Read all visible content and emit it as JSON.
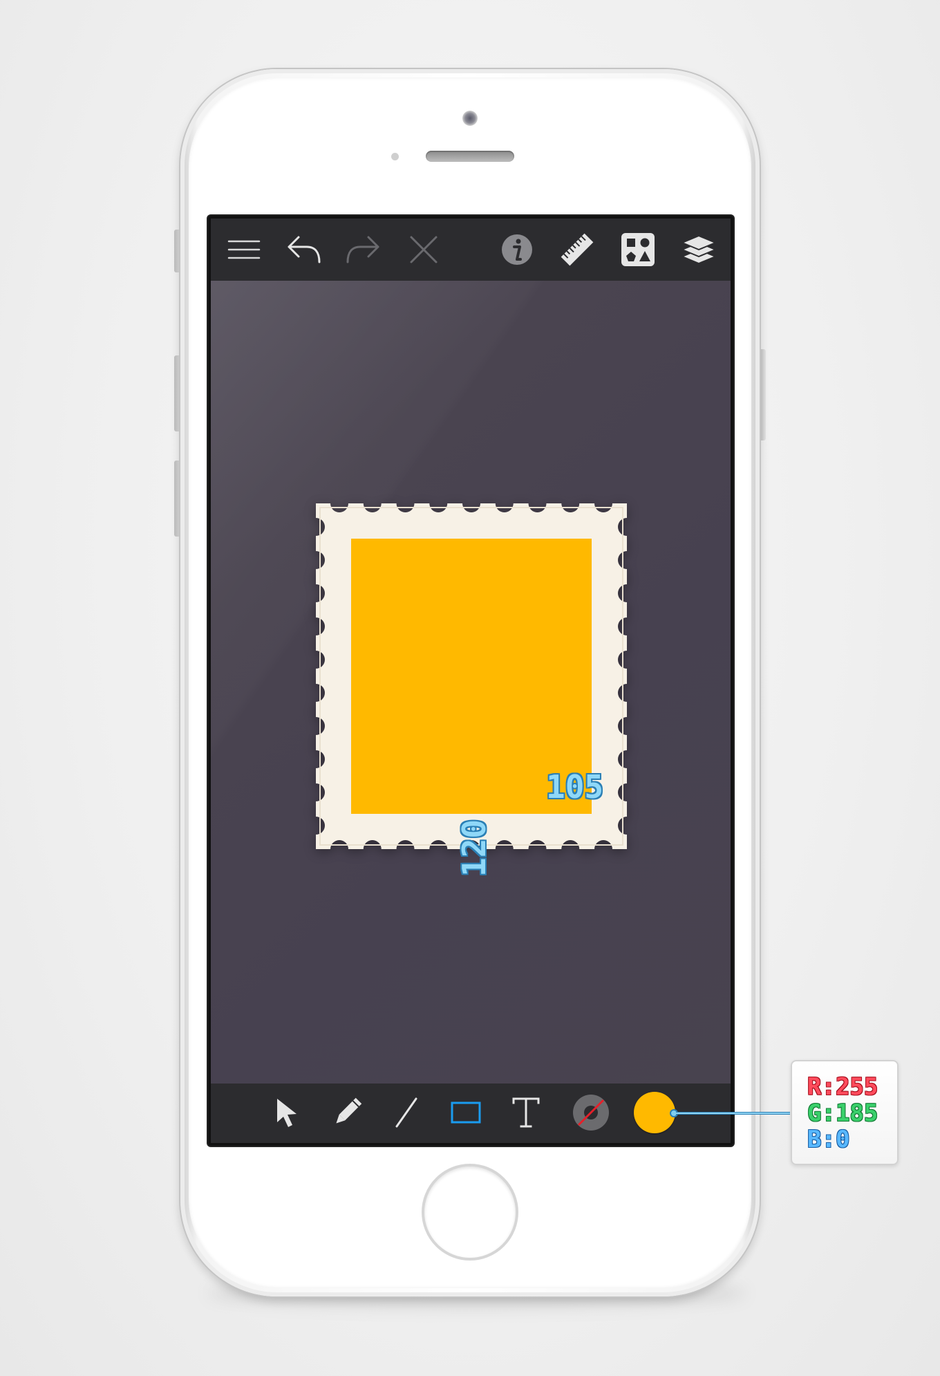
{
  "toolbar_top": {
    "icons": [
      "menu-icon",
      "undo-icon",
      "redo-icon",
      "close-icon",
      "info-icon",
      "ruler-icon",
      "shapes-icon",
      "layers-icon"
    ]
  },
  "canvas": {
    "stamp": {
      "border_color": "#f7f1e6",
      "fill_color": "#ffb900",
      "width_label": "105",
      "height_label": "120"
    }
  },
  "toolbar_bottom": {
    "tools": [
      "select-arrow-icon",
      "pencil-icon",
      "line-icon",
      "rectangle-icon",
      "text-icon",
      "stroke-none-icon",
      "fill-color-swatch"
    ],
    "active_tool": "rectangle-icon",
    "accent_color": "#1a9cf0"
  },
  "color_readout": {
    "r": "R:255",
    "g": "G:185",
    "b": "B:0"
  }
}
